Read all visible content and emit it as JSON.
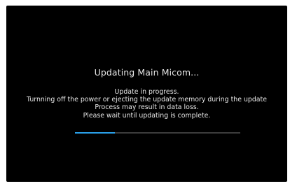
{
  "update_screen": {
    "title": "Updating Main Micom...",
    "message_lines": [
      "Update in progress.",
      "Turnning off the power or ejecting the update memory during the update",
      "Process may result in data loss.",
      "Please wait until updating is complete."
    ],
    "progress_fraction": 0.24
  },
  "colors": {
    "background": "#000000",
    "text": "#e6e6e6",
    "progress_fill": "#2aa0e8",
    "progress_track": "#3c3c3c"
  }
}
